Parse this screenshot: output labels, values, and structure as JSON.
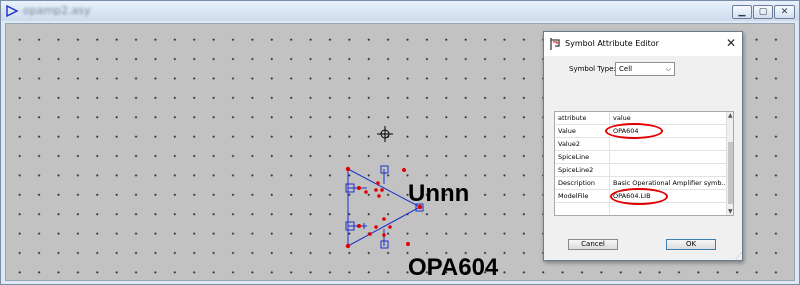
{
  "window": {
    "title": "opamp2.asy",
    "controls": {
      "minimize": "▁",
      "maximize": "▢",
      "close": "✕"
    }
  },
  "schematic": {
    "reference_label": "Unnn",
    "value_label": "OPA604"
  },
  "dialog": {
    "title": "Symbol Attribute Editor",
    "close_glyph": "✕",
    "symbol_type_label": "Symbol Type:",
    "symbol_type_value": "Cell",
    "table": {
      "headers": {
        "attribute": "attribute",
        "value": "value"
      },
      "rows": [
        {
          "attribute": "Value",
          "value": "OPA604"
        },
        {
          "attribute": "Value2",
          "value": ""
        },
        {
          "attribute": "SpiceLine",
          "value": ""
        },
        {
          "attribute": "SpiceLine2",
          "value": ""
        },
        {
          "attribute": "Description",
          "value": "Basic Operational Amplifier symb..."
        },
        {
          "attribute": "ModelFile",
          "value": "OPA604.LIB"
        }
      ]
    },
    "buttons": {
      "cancel": "Cancel",
      "ok": "OK"
    }
  },
  "colors": {
    "canvas_background": "#c2c2c2",
    "symbol_line": "#1c30c8",
    "pin_marker": "#e10000",
    "highlight_oval": "#e10000"
  }
}
